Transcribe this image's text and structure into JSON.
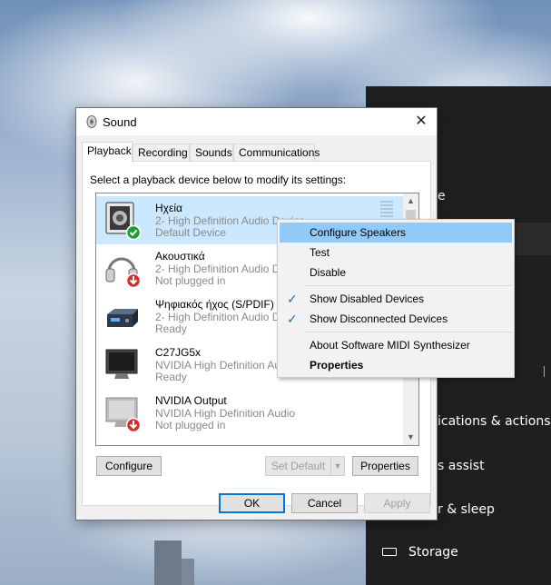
{
  "settings_panel": {
    "items": [
      {
        "label": "e",
        "top": 0
      },
      {
        "label": "ications & actions"
      },
      {
        "label": "s assist"
      },
      {
        "label": "r & sleep"
      },
      {
        "label": "Storage"
      }
    ],
    "storage_label": "Storage"
  },
  "dialog": {
    "title": "Sound",
    "close_glyph": "✕",
    "tabs": [
      {
        "label": "Playback",
        "active": true
      },
      {
        "label": "Recording"
      },
      {
        "label": "Sounds"
      },
      {
        "label": "Communications"
      }
    ],
    "instruction": "Select a playback device below to modify its settings:",
    "devices": [
      {
        "name": "Ηχεία",
        "description": "2- High Definition Audio Device",
        "status": "Default Device",
        "icon": "speaker-icon",
        "badge": "default-check"
      },
      {
        "name": "Ακουστικά",
        "description": "2- High Definition Audio De",
        "status": "Not plugged in",
        "icon": "headphones-icon",
        "badge": "unplugged-arrow"
      },
      {
        "name": "Ψηφιακός ήχος (S/PDIF)",
        "description": "2- High Definition Audio De",
        "status": "Ready",
        "icon": "spdif-icon"
      },
      {
        "name": "C27JG5x",
        "description": "NVIDIA High Definition Au",
        "status": "Ready",
        "icon": "monitor-icon"
      },
      {
        "name": "NVIDIA Output",
        "description": "NVIDIA High Definition Audio",
        "status": "Not plugged in",
        "icon": "monitor-icon",
        "badge": "unplugged-arrow"
      }
    ],
    "buttons": {
      "configure": "Configure",
      "set_default": "Set Default",
      "properties": "Properties",
      "ok": "OK",
      "cancel": "Cancel",
      "apply": "Apply"
    }
  },
  "context_menu": {
    "items": [
      {
        "label": "Configure Speakers",
        "hover": true
      },
      {
        "label": "Test"
      },
      {
        "label": "Disable"
      },
      {
        "label": "Show Disabled Devices",
        "checked": true
      },
      {
        "label": "Show Disconnected Devices",
        "checked": true
      },
      {
        "label": "About Software MIDI Synthesizer"
      },
      {
        "label": "Properties",
        "bold": true
      }
    ],
    "check_glyph": "✓"
  },
  "colors": {
    "selection": "#cce8ff",
    "menu_hover": "#91c9f7",
    "accent": "#0078d7",
    "settings_bg": "#1f1f1f"
  }
}
